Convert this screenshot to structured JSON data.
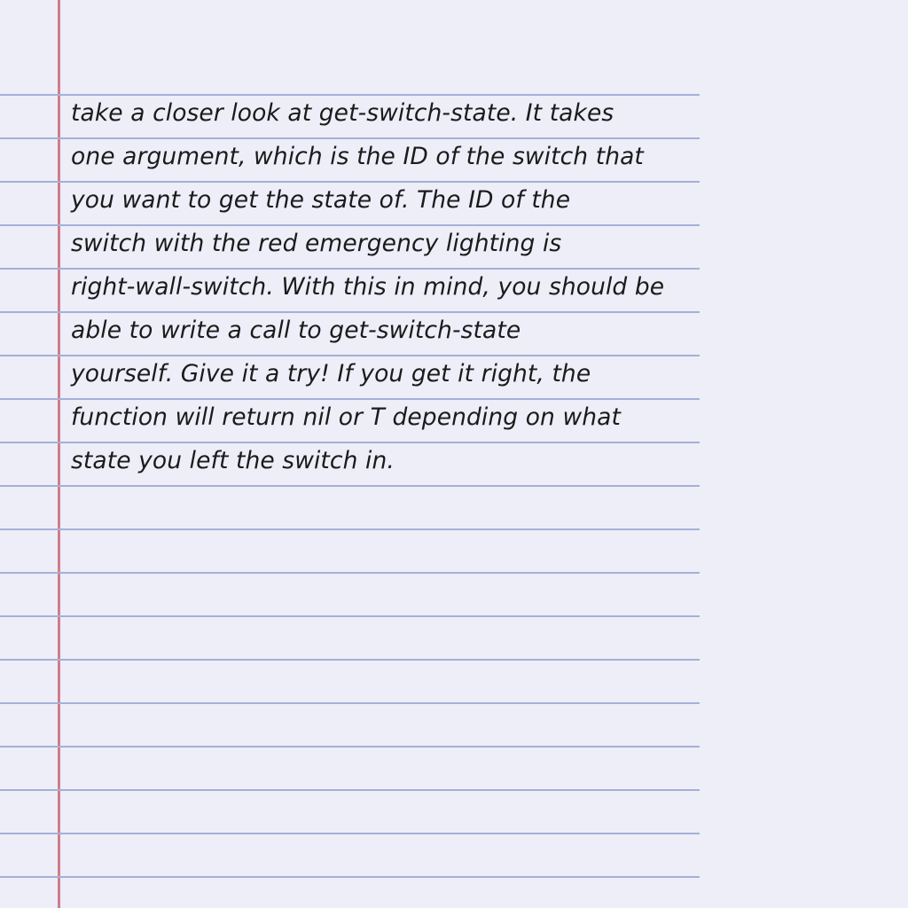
{
  "document": {
    "lines": [
      "take a closer look at get-switch-state. It takes",
      "one argument, which is the ID of the switch that",
      "you want to get the state of. The ID of the",
      "switch with the red emergency lighting is",
      "right-wall-switch. With this in mind, you should be",
      "able to write a call to get-switch-state",
      "yourself. Give it a try! If you get it right, the",
      "function will return nil or T depending on what",
      "state you left the switch in."
    ]
  },
  "colors": {
    "paper": "#edeef8",
    "rule_line": "#a6b0d6",
    "margin_line": "#d27b8e",
    "ink": "#1b1b1b"
  }
}
